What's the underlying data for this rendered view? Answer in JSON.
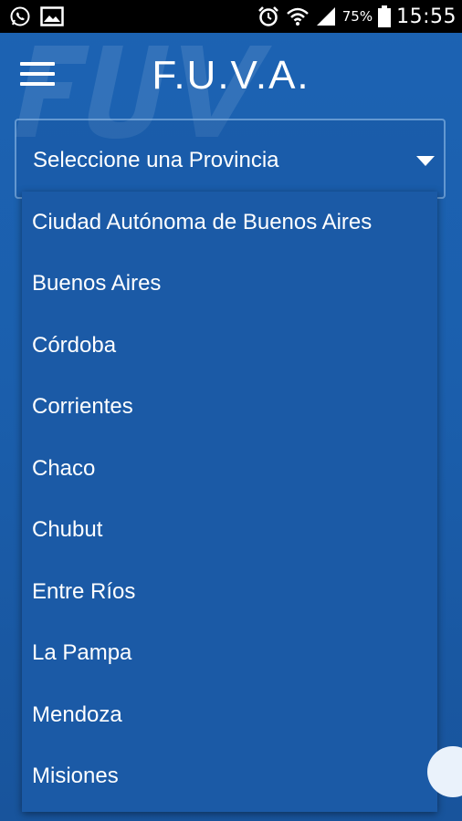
{
  "status_bar": {
    "time": "15:55",
    "battery_percent": "75%",
    "icons": [
      "whatsapp-icon",
      "image-icon",
      "alarm-icon",
      "wifi-icon",
      "signal-icon",
      "battery-icon"
    ]
  },
  "app_bar": {
    "title": "F.U.V.A.",
    "menu_icon": "hamburger-menu-icon"
  },
  "spinner": {
    "label": "Seleccione una Provincia",
    "arrow_icon": "dropdown-arrow-icon"
  },
  "dropdown": {
    "items": [
      "Ciudad Autónoma de Buenos Aires",
      "Buenos Aires",
      "Córdoba",
      "Corrientes",
      "Chaco",
      "Chubut",
      "Entre Ríos",
      "La Pampa",
      "Mendoza",
      "Misiones"
    ]
  },
  "colors": {
    "background": "#1c63b3",
    "dropdown_bg": "#1b5aa6",
    "status_bar": "#000000",
    "text": "#ffffff"
  }
}
